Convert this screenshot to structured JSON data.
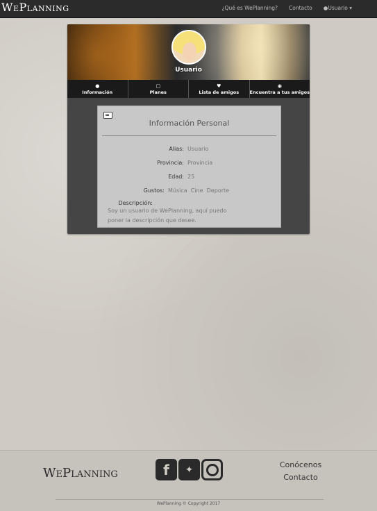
{
  "navbar": {
    "brand": "WePlanning",
    "links": [
      "¿Qué es WePlanning?",
      "Contacto"
    ],
    "user_menu": "Usuario"
  },
  "profile": {
    "name": "Usuario",
    "tabs": [
      {
        "label": "Información",
        "icon": "user-icon"
      },
      {
        "label": "Planes",
        "icon": "book-icon"
      },
      {
        "label": "Lista de amigos",
        "icon": "heart-icon"
      },
      {
        "label": "Encuentra a tus amigos",
        "icon": "globe-icon"
      }
    ]
  },
  "info": {
    "title": "Información Personal",
    "alias_label": "Alias:",
    "alias_value": "Usuario",
    "provincia_label": "Provincia:",
    "provincia_value": "Provincia",
    "edad_label": "Edad:",
    "edad_value": "25",
    "gustos_label": "Gustos:",
    "gustos_value": "Música  Cine  Deporte",
    "descripcion_label": "Descripción:",
    "descripcion_value": "Soy un usuario de WePlanning, aquí puedo poner la descripción que desee."
  },
  "footer": {
    "brand": "WePlanning",
    "links": [
      "Conócenos",
      "Contacto"
    ],
    "copyright": "WePlanning © Copyright 2017"
  }
}
